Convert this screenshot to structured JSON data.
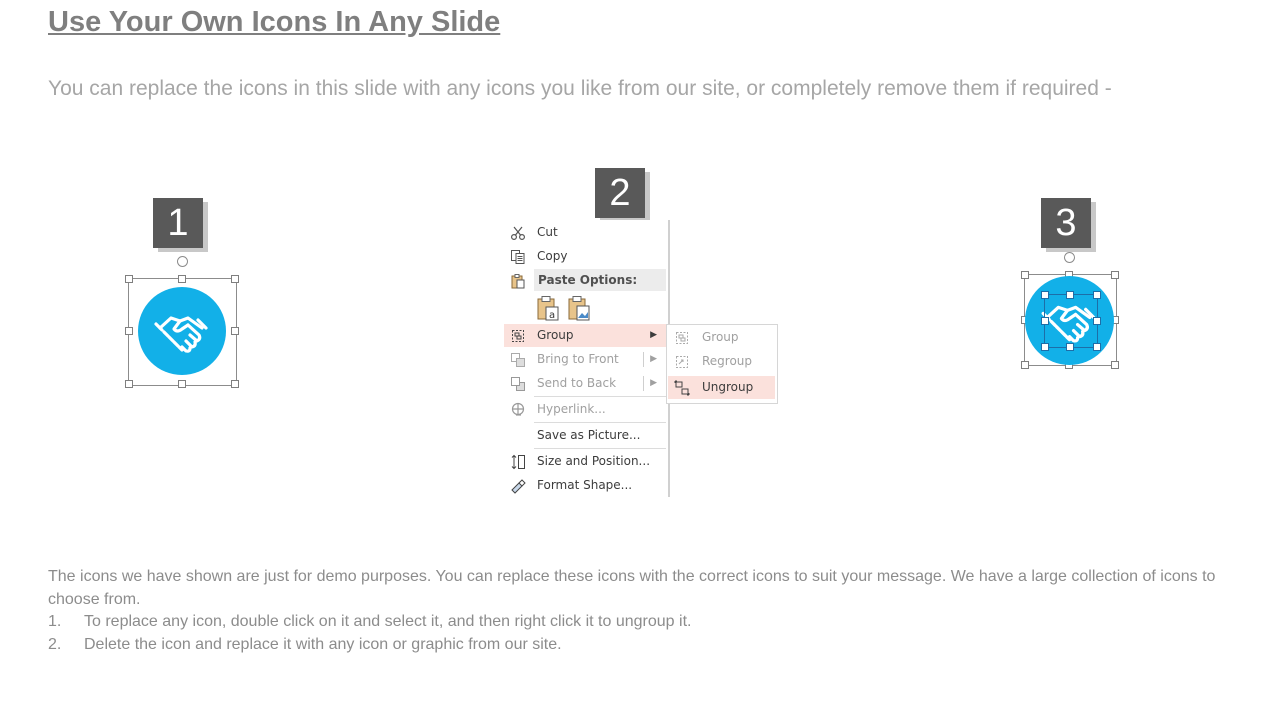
{
  "slide": {
    "title": "Use Your Own Icons In Any Slide",
    "subtitle": "You can replace the icons in this slide with any icons you like from our site, or completely remove them if required -"
  },
  "steps": [
    "1",
    "2",
    "3"
  ],
  "icons": {
    "color": "#12b0e8",
    "icon_name": "handshake-icon"
  },
  "context_menu": {
    "cut": "Cut",
    "copy": "Copy",
    "paste_options": "Paste Options:",
    "group": "Group",
    "bring_to_front": "Bring to Front",
    "send_to_back": "Send to Back",
    "hyperlink": "Hyperlink...",
    "save_as_picture": "Save as Picture...",
    "size_and_position": "Size and Position...",
    "format_shape": "Format Shape..."
  },
  "submenu": {
    "group": "Group",
    "regroup": "Regroup",
    "ungroup": "Ungroup"
  },
  "footer": {
    "intro": "The icons we have shown are just for demo purposes. You can replace these icons with the correct icons to suit your message. We have a large collection of icons to choose from.",
    "items": [
      {
        "num": "1.",
        "text": "To replace any icon, double click on it and select it, and then right click it to ungroup it."
      },
      {
        "num": "2.",
        "text": "Delete the icon and replace it with any icon or graphic from our site."
      }
    ]
  },
  "colors": {
    "accent": "#12b0e8",
    "step_box": "#595959",
    "highlight": "#fbe1dc"
  }
}
